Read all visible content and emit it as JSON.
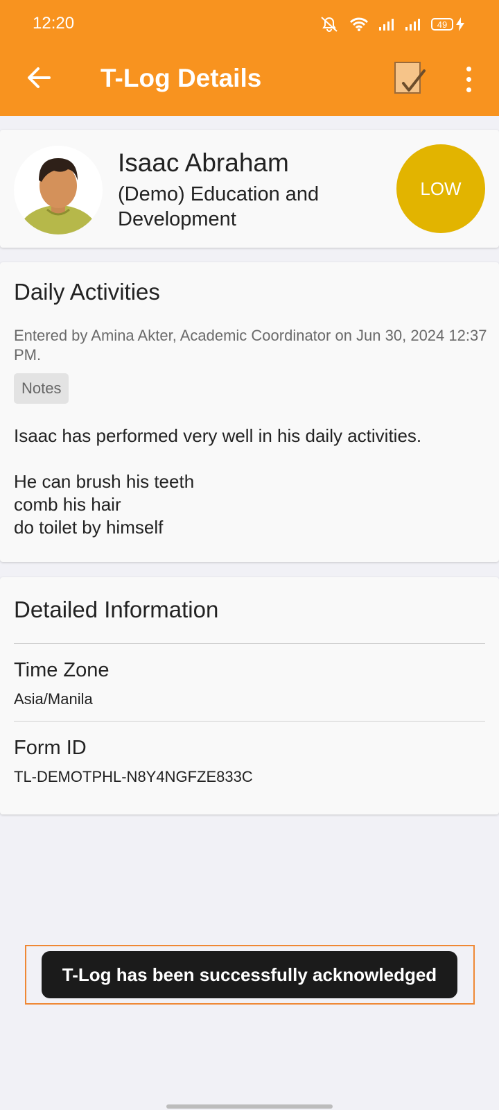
{
  "status_bar": {
    "time": "12:20",
    "battery_level": "49",
    "icons": [
      "mute-vibrate-icon",
      "wifi-icon",
      "signal-icon",
      "signal-icon",
      "battery-icon",
      "charging-icon"
    ]
  },
  "app_bar": {
    "title": "T-Log Details",
    "actions": [
      "back-arrow-icon",
      "acknowledge-icon",
      "more-vert-icon"
    ]
  },
  "profile": {
    "name": "Isaac Abraham",
    "program": "(Demo) Education and Development",
    "risk_level": "LOW",
    "risk_color": "#e2b400"
  },
  "activity": {
    "title": "Daily Activities",
    "entered_by": "Entered by Amina Akter, Academic Coordinator on Jun 30, 2024 12:37 PM.",
    "tag": "Notes",
    "note_lines": [
      "Isaac has performed very well in his daily activities.",
      "He can brush his teeth",
      "comb his hair",
      "do toilet by himself"
    ]
  },
  "details": {
    "title": "Detailed Information",
    "fields": [
      {
        "label": "Time Zone",
        "value": "Asia/Manila"
      },
      {
        "label": "Form ID",
        "value": "TL-DEMOTPHL-N8Y4NGFZE833C"
      }
    ]
  },
  "toast": {
    "message": "T-Log has been successfully acknowledged"
  },
  "colors": {
    "app_bar": "#f8931f",
    "risk_low": "#e2b400",
    "toast_bg": "#1b1b1b",
    "highlight_outline": "#ef8834"
  }
}
